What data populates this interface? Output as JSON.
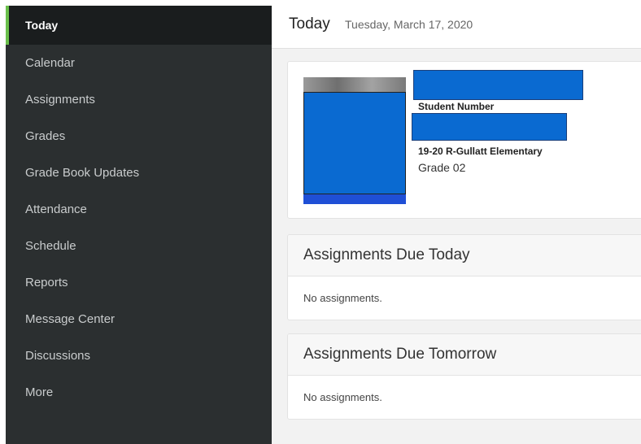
{
  "sidebar": {
    "items": [
      {
        "label": "Today"
      },
      {
        "label": "Calendar"
      },
      {
        "label": "Assignments"
      },
      {
        "label": "Grades"
      },
      {
        "label": "Grade Book Updates"
      },
      {
        "label": "Attendance"
      },
      {
        "label": "Schedule"
      },
      {
        "label": "Reports"
      },
      {
        "label": "Message Center"
      },
      {
        "label": "Discussions"
      },
      {
        "label": "More"
      }
    ],
    "active_accent": "#6abf4b"
  },
  "header": {
    "title": "Today",
    "date": "Tuesday, March 17, 2020"
  },
  "student": {
    "number_label": "Student Number",
    "school": "19-20 R-Gullatt Elementary",
    "grade": "Grade 02",
    "redaction_color": "#0a6ad1"
  },
  "sections": {
    "today": {
      "title": "Assignments Due Today",
      "empty_text": "No assignments."
    },
    "tomorrow": {
      "title": "Assignments Due Tomorrow",
      "empty_text": "No assignments."
    }
  }
}
